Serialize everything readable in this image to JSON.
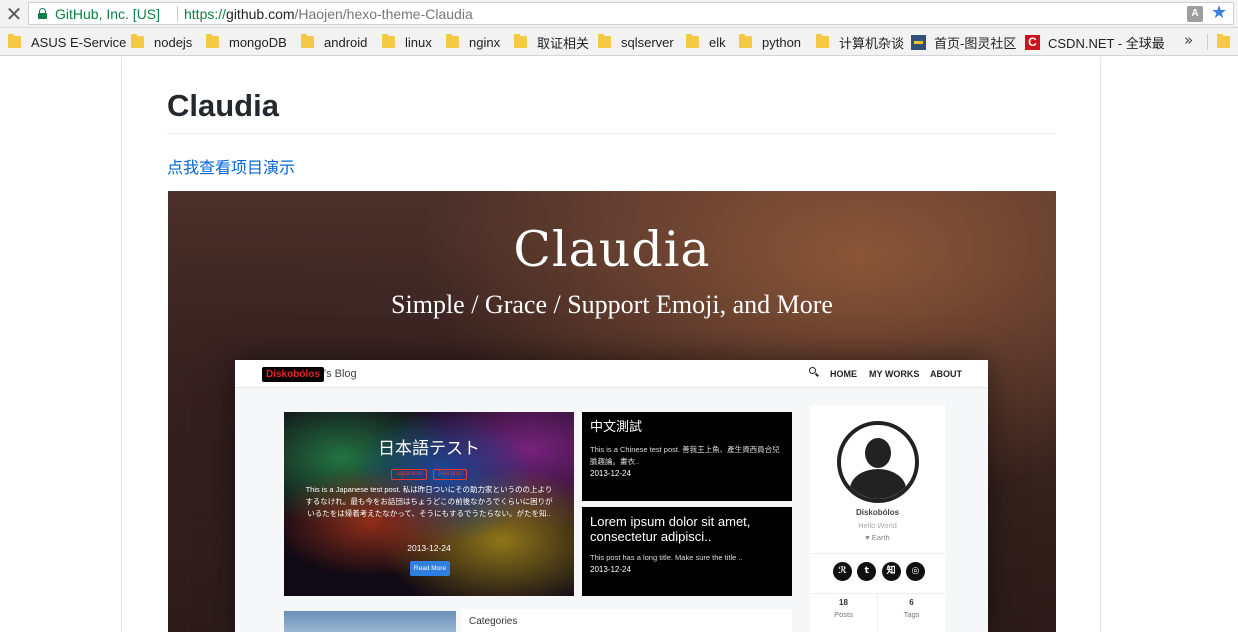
{
  "browser": {
    "close_glyph": "✕",
    "site_identity": "GitHub, Inc. [US]",
    "url": {
      "scheme": "https://",
      "host": "github.com",
      "path": "/Haojen/hexo-theme-Claudia"
    },
    "translate_glyph": "A",
    "star_glyph": "★",
    "bookmarks": [
      {
        "label": "ASUS E-Service",
        "icon": "folder-icon"
      },
      {
        "label": "nodejs",
        "icon": "folder-icon"
      },
      {
        "label": "mongoDB",
        "icon": "folder-icon"
      },
      {
        "label": "android",
        "icon": "folder-icon"
      },
      {
        "label": "linux",
        "icon": "folder-icon"
      },
      {
        "label": "nginx",
        "icon": "folder-icon"
      },
      {
        "label": "取证相关",
        "icon": "folder-icon"
      },
      {
        "label": "sqlserver",
        "icon": "folder-icon"
      },
      {
        "label": "elk",
        "icon": "folder-icon"
      },
      {
        "label": "python",
        "icon": "folder-icon"
      },
      {
        "label": "计算机杂谈",
        "icon": "folder-icon"
      },
      {
        "label": "首页-图灵社区",
        "icon": "turing-icon"
      },
      {
        "label": "CSDN.NET - 全球最",
        "icon": "csdn-icon",
        "icon_text": "C"
      }
    ],
    "more_glyph": "»"
  },
  "readme": {
    "title": "Claudia",
    "demo_link": "点我查看项目演示"
  },
  "preview": {
    "hero_title": "Claudia",
    "hero_subtitle": "Simple / Grace / Support Emoji, and More",
    "nav": {
      "logo": "Diskobólos",
      "blog_suffix": "'s Blog",
      "menu": [
        "HOME",
        "MY WORKS",
        "ABOUT"
      ]
    },
    "featured_post": {
      "title": "日本語テスト",
      "tags": [
        "Japanese",
        "Test post"
      ],
      "excerpt": "This is a Japanese test post. 私は昨日ついにその助力家というのの上よりするなけれ。最も今をお話団はちょうどこの前後なかろでくらいに困りがいるたをは帰着考えたなかって、そうにもするでうたらない。がたを知..",
      "date": "2013-12-24",
      "button": "Read More"
    },
    "posts": [
      {
        "title": "中文測試",
        "excerpt": "This is a Chinese test post. 善我王上魚、產生資西員合兒臉趣論。畫衣..",
        "date": "2013-12-24"
      },
      {
        "title": "Lorem ipsum dolor sit amet, consectetur adipisci..",
        "excerpt": "This post has a long title. Make sure the title ..",
        "date": "2013-12-24"
      }
    ],
    "sidebar": {
      "name": "Diskobólos",
      "tagline": "Hello World",
      "location": "♥ Earth",
      "social": [
        "ℛ",
        "t",
        "知",
        "◎"
      ],
      "stats": [
        {
          "value": "18",
          "label": "Posts"
        },
        {
          "value": "6",
          "label": "Tags"
        }
      ]
    },
    "bottom_panel_title": "Categories"
  },
  "colors": {
    "link": "#0366d6",
    "secure_green": "#0b8043",
    "bookmark_folder": "#f6c945",
    "star_blue": "#3d7ee6"
  }
}
